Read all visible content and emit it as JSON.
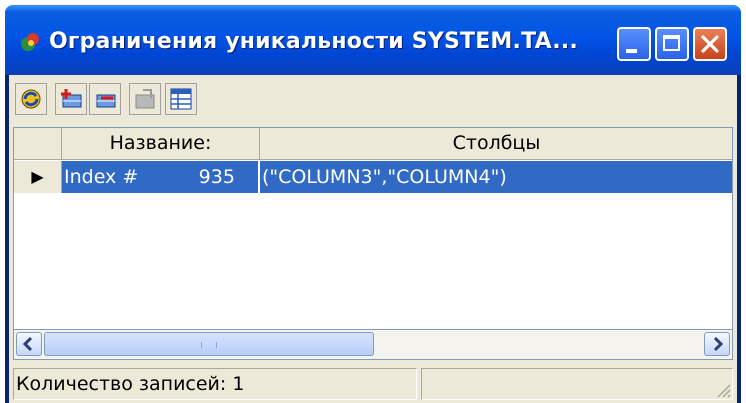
{
  "window": {
    "title": "Ограничения уникальности SYSTEM.TA...",
    "title_icon": "app-icon",
    "controls": [
      "minimize-icon",
      "maximize-icon",
      "close-icon"
    ]
  },
  "toolbar": {
    "buttons": [
      {
        "name": "refresh-button",
        "icon": "refresh-icon"
      },
      {
        "name": "add-button",
        "icon": "add-icon"
      },
      {
        "name": "delete-button",
        "icon": "delete-icon"
      },
      {
        "name": "edit-button",
        "icon": "edit-icon",
        "enabled": false
      },
      {
        "name": "view-button",
        "icon": "grid-view-icon"
      }
    ]
  },
  "grid": {
    "columns": [
      "Название:",
      "Столбцы"
    ],
    "rows": [
      {
        "name": "Index #          935",
        "columns": "(\"COLUMN3\",\"COLUMN4\")",
        "selected": true
      }
    ],
    "row_indicator": "▶"
  },
  "status": {
    "record_count": "Количество записей: 1",
    "secondary": ""
  },
  "colors": {
    "selection": "#316ac5",
    "titlebar": "#0254e6",
    "face": "#ece9d8"
  }
}
